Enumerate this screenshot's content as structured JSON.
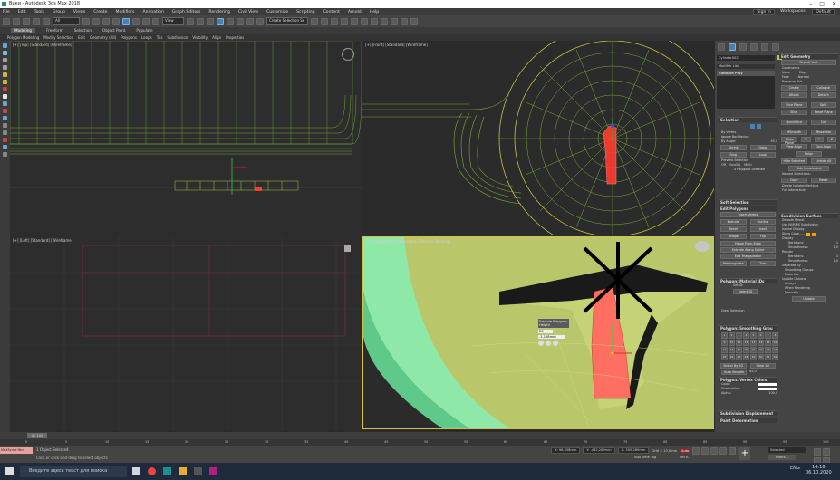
{
  "window": {
    "title": "Вики - Autodesk 3ds Max 2018"
  },
  "menu": {
    "items": [
      "File",
      "Edit",
      "Tools",
      "Group",
      "Views",
      "Create",
      "Modifiers",
      "Animation",
      "Graph Editors",
      "Rendering",
      "Civil View",
      "Customize",
      "Scripting",
      "Content",
      "Arnold",
      "Help"
    ],
    "signin": "Sign In",
    "workspaces_label": "Workspaces:",
    "workspace_value": "Default"
  },
  "toolbar": {
    "selection_filter": "All",
    "view_dropdown": "View",
    "create_selection_set": "Create Selection Se"
  },
  "ribbon": {
    "tabs": [
      "Modeling",
      "Freeform",
      "Selection",
      "Object Paint",
      "Populate"
    ],
    "active_tab": "Modeling",
    "subitems": [
      "Polygon Modeling",
      "Modify Selection",
      "Edit",
      "Geometry (All)",
      "Polygons",
      "Loops",
      "Tris",
      "Subdivision",
      "Visibility",
      "Align",
      "Properties"
    ]
  },
  "viewports": {
    "top": "[+] [Top] [Standard] [Wireframe]",
    "front": "[+] [Front] [Standard] [Wireframe]",
    "left": "[+] [Left] [Standard] [Wireframe]",
    "perspective": "[+] [Perspective] [Standard] [Default Shading]"
  },
  "caddy": {
    "title": "Extrude Polygons",
    "subtitle": "Height",
    "type_value": "26",
    "height_value": "-1,108mm"
  },
  "command_panel": {
    "object_name": "Cylinder002",
    "modifier_list": "Modifier List",
    "stack_item": "Editable Poly",
    "selection": {
      "header": "Selection",
      "by_vertex": "By Vertex",
      "ignore_backfacing": "Ignore Backfacing",
      "by_angle": "By Angle:",
      "angle": "45,0",
      "shrink": "Shrink",
      "grow": "Grow",
      "ring": "Ring",
      "loop": "Loop",
      "preview_selection": "Preview Selection",
      "off": "Off",
      "subobj": "SubObj",
      "multi": "Multi",
      "status": "4 Polygons Selected"
    },
    "soft_selection": "Soft Selection",
    "edit_polygons": {
      "header": "Edit Polygons",
      "insert_vertex": "Insert Vertex",
      "extrude": "Extrude",
      "outline": "Outline",
      "bevel": "Bevel",
      "inset": "Inset",
      "bridge": "Bridge",
      "flip": "Flip",
      "hinge_from_edge": "Hinge From Edge",
      "extrude_along_spline": "Extrude Along Spline",
      "edit_triangulation": "Edit Triangulation",
      "retriangulate": "Retriangulate",
      "turn": "Turn"
    },
    "material_ids": {
      "header": "Polygon: Material IDs",
      "set_id": "Set ID:",
      "select_id": "Select ID",
      "clear_selection": "Clear Selection"
    },
    "smoothing_groups": {
      "header": "Polygon: Smoothing Grou",
      "numbers": [
        "1",
        "2",
        "3",
        "4",
        "5",
        "6",
        "7",
        "8",
        "9",
        "10",
        "11",
        "12",
        "13",
        "14",
        "15",
        "16",
        "17",
        "18",
        "19",
        "20",
        "21",
        "22",
        "23",
        "24",
        "25",
        "26",
        "27",
        "28",
        "29",
        "30",
        "31",
        "32"
      ],
      "select_by_sg": "Select By SG",
      "clear_all": "Clear All",
      "auto_smooth": "Auto Smooth",
      "auto_value": "45,0"
    },
    "vertex_colors": {
      "header": "Polygon: Vertex Colors",
      "color": "Color:",
      "illumination": "Illumination:",
      "alpha": "Alpha:",
      "alpha_value": "100,0"
    },
    "subdivision_displacement": "Subdivision Displacement",
    "paint_deformation": "Paint Deformation",
    "edit_geometry": {
      "header": "Edit Geometry",
      "repeat_last": "Repeat Last",
      "constraints": "Constraints",
      "none": "None",
      "edge": "Edge",
      "face": "Face",
      "normal": "Normal",
      "preserve_uvs": "Preserve UVs",
      "create": "Create",
      "collapse": "Collapse",
      "attach": "Attach",
      "detach": "Detach",
      "slice_plane": "Slice Plane",
      "split": "Split",
      "slice": "Slice",
      "reset_plane": "Reset Plane",
      "quickslice": "QuickSlice",
      "cut": "Cut",
      "msmooth": "MSmooth",
      "tessellate": "Tessellate",
      "make_planar": "Make Planar",
      "x": "X",
      "y": "Y",
      "z": "Z",
      "view_align": "View Align",
      "grid_align": "Grid Align",
      "relax": "Relax",
      "hide_selected": "Hide Selected",
      "unhide_all": "Unhide All",
      "hide_unselected": "Hide Unselected",
      "named_selections": "Named Selections:",
      "copy": "Copy",
      "paste": "Paste",
      "delete_isolated": "Delete Isolated Vertices",
      "full_interactivity": "Full Interactivity"
    },
    "subdivision_surface": {
      "header": "Subdivision Surface",
      "smooth_result": "Smooth Result",
      "use_nurms": "Use NURMS Subdivision",
      "isoline_display": "Isoline Display",
      "show_cage": "Show Cage......",
      "display": "Display",
      "iterations": "Iterations:",
      "iterations_value": "1",
      "smoothness": "Smoothness:",
      "smoothness_value": "1,0",
      "render": "Render",
      "separate_by": "Separate By",
      "smoothing_groups": "Smoothing Groups",
      "materials": "Materials",
      "update_options": "Update Options",
      "always": "Always",
      "when_rendering": "When Rendering",
      "manually": "Manually",
      "update": "Update"
    }
  },
  "timeline": {
    "frame": "0 / 100",
    "ticks": [
      "0",
      "5",
      "10",
      "15",
      "20",
      "25",
      "30",
      "35",
      "40",
      "45",
      "50",
      "55",
      "60",
      "65",
      "70",
      "75",
      "80",
      "85",
      "90",
      "95",
      "100"
    ]
  },
  "status": {
    "maxscript": "MAXScript Mini",
    "selected": "1 Object Selected",
    "prompt": "Click or click-and-drag to select objects",
    "x": "X: 96,356mm",
    "y": "Y: -432,209mm",
    "z": "Z: 505,289mm",
    "grid": "Grid = 10,0mm",
    "add_time_tag": "Add Time Tag",
    "auto": "Auto",
    "set_key": "Set K.",
    "selected_dd": "Selected",
    "filters": "Filters...",
    "frame_value": "0"
  },
  "taskbar": {
    "search_placeholder": "Введите здесь текст для поиска",
    "lang": "ENG",
    "time": "14:18",
    "date": "06.10.2020"
  },
  "colors": {
    "wire_green": "#8fd14f",
    "selected_red": "#ff3b30",
    "perspective_bg": "#b9c76a",
    "accent": "#4a7fb5"
  }
}
